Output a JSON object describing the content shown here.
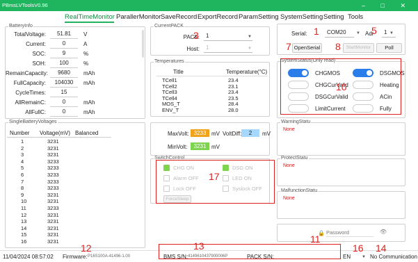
{
  "app": {
    "title": "PBmsLVToolsV0.96",
    "controls": "–  □  ✕"
  },
  "menu": [
    "RealTimeMonitor",
    "ParallerMonitor",
    "SaveRecord",
    "ExportRecord",
    "ParamSetting",
    "SystemSetting",
    "Setting",
    "Tools"
  ],
  "battery_info": {
    "title": "BatteryInfo",
    "rows": [
      {
        "label": "TotalVoltage:",
        "value": "51.81",
        "unit": "V"
      },
      {
        "label": "Current:",
        "value": "0",
        "unit": "A"
      },
      {
        "label": "SOC:",
        "value": "9",
        "unit": "%"
      },
      {
        "label": "SOH:",
        "value": "100",
        "unit": "%"
      },
      {
        "label": "RemainCapacity:",
        "value": "9680",
        "unit": "mAh"
      },
      {
        "label": "FullCapacity:",
        "value": "104030",
        "unit": "mAh"
      },
      {
        "label": "CycleTimes:",
        "value": "15",
        "unit": ""
      },
      {
        "label": "AllRemainC:",
        "value": "0",
        "unit": "mAh"
      },
      {
        "label": "AllFullC:",
        "value": "0",
        "unit": "mAh"
      }
    ]
  },
  "current_pack": {
    "title": "CurrentPACK",
    "pack_label": "PACK:",
    "pack_value": "1",
    "host_label": "Host:",
    "host_value": "1"
  },
  "temperatures": {
    "title": "Temperatures",
    "headers": [
      "Title",
      "Temperature(°C)"
    ],
    "rows": [
      [
        "TCell1",
        "23.4"
      ],
      [
        "TCell2",
        "23.1"
      ],
      [
        "TCell3",
        "23.4"
      ],
      [
        "TCell4",
        "23.5"
      ],
      [
        "MOS_T",
        "28.4"
      ],
      [
        "ENV_T",
        "28.0"
      ]
    ]
  },
  "serial": {
    "serial_label": "Serial:",
    "port": "COM20",
    "addr_label": "Adr",
    "addr": "1",
    "open_label": "OpenSerial",
    "start_label": "StartMonitor",
    "poll_label": "Poll"
  },
  "system_status": {
    "title": "SystemStatus(Only read)",
    "items": [
      {
        "label": "CHGMOS",
        "on": true
      },
      {
        "label": "DSGMOS",
        "on": true
      },
      {
        "label": "CHGCurValid",
        "on": false
      },
      {
        "label": "Heating",
        "on": false
      },
      {
        "label": "DSGCurValid",
        "on": false
      },
      {
        "label": "ACin",
        "on": false
      },
      {
        "label": "LimitCurrent",
        "on": false
      },
      {
        "label": "Fully",
        "on": false
      }
    ]
  },
  "single_voltages": {
    "title": "SingleBatteryVoltages",
    "headers": [
      "Number",
      "Voltage(mV)",
      "Balanced"
    ],
    "rows": [
      [
        "1",
        "3231"
      ],
      [
        "2",
        "3231"
      ],
      [
        "3",
        "3231"
      ],
      [
        "4",
        "3233"
      ],
      [
        "5",
        "3233"
      ],
      [
        "6",
        "3233"
      ],
      [
        "7",
        "3233"
      ],
      [
        "8",
        "3233"
      ],
      [
        "9",
        "3231"
      ],
      [
        "10",
        "3231"
      ],
      [
        "11",
        "3233"
      ],
      [
        "12",
        "3231"
      ],
      [
        "13",
        "3231"
      ],
      [
        "14",
        "3231"
      ],
      [
        "15",
        "3231"
      ],
      [
        "16",
        "3231"
      ]
    ]
  },
  "volt_summary": {
    "max_label": "MaxVolt:",
    "max_value": "3233",
    "min_label": "MinVolt:",
    "min_value": "3231",
    "diff_label": "VoltDiff:",
    "diff_value": "2",
    "unit": "mV"
  },
  "switch_control": {
    "title": "SwitchControl",
    "items": [
      {
        "label": "CHG ON",
        "on": true
      },
      {
        "label": "DSG ON",
        "on": true
      },
      {
        "label": "Alarm OFF",
        "on": false
      },
      {
        "label": "LED ON",
        "on": false
      },
      {
        "label": "Lock OFF",
        "on": false
      },
      {
        "label": "Syslock OFF",
        "on": false
      }
    ],
    "button_label": "ForceSleep"
  },
  "warning": {
    "title": "WarningStatu",
    "value": "None"
  },
  "protect": {
    "title": "ProtectStatu",
    "value": "None"
  },
  "malfunction": {
    "title": "MalfunctionStatu",
    "value": "None"
  },
  "password": {
    "placeholder": "Password"
  },
  "status_bar": {
    "datetime": "11/04/2024 08:57:02",
    "firmware_label": "Firmware:",
    "firmware_value": "P16S100A-41496-1.00",
    "bms_sn_label": "BMS S/N:",
    "bms_sn_value": "4149610437900006P",
    "pack_sn_label": "PACK S/N:",
    "pack_sn_value": "",
    "lang": "EN",
    "comm": "No Communication"
  },
  "annotations": [
    "1",
    "3",
    "5",
    "7",
    "8",
    "10",
    "11",
    "12",
    "13",
    "14",
    "16",
    "17"
  ],
  "colors": {
    "accent": "#1fb55e",
    "annotation": "#e0201c",
    "toggle_on": "#2b7de9",
    "max_volt_bg": "#f0a21b",
    "min_volt_bg": "#7fd44f",
    "diff_bg": "#a6d8ff"
  }
}
